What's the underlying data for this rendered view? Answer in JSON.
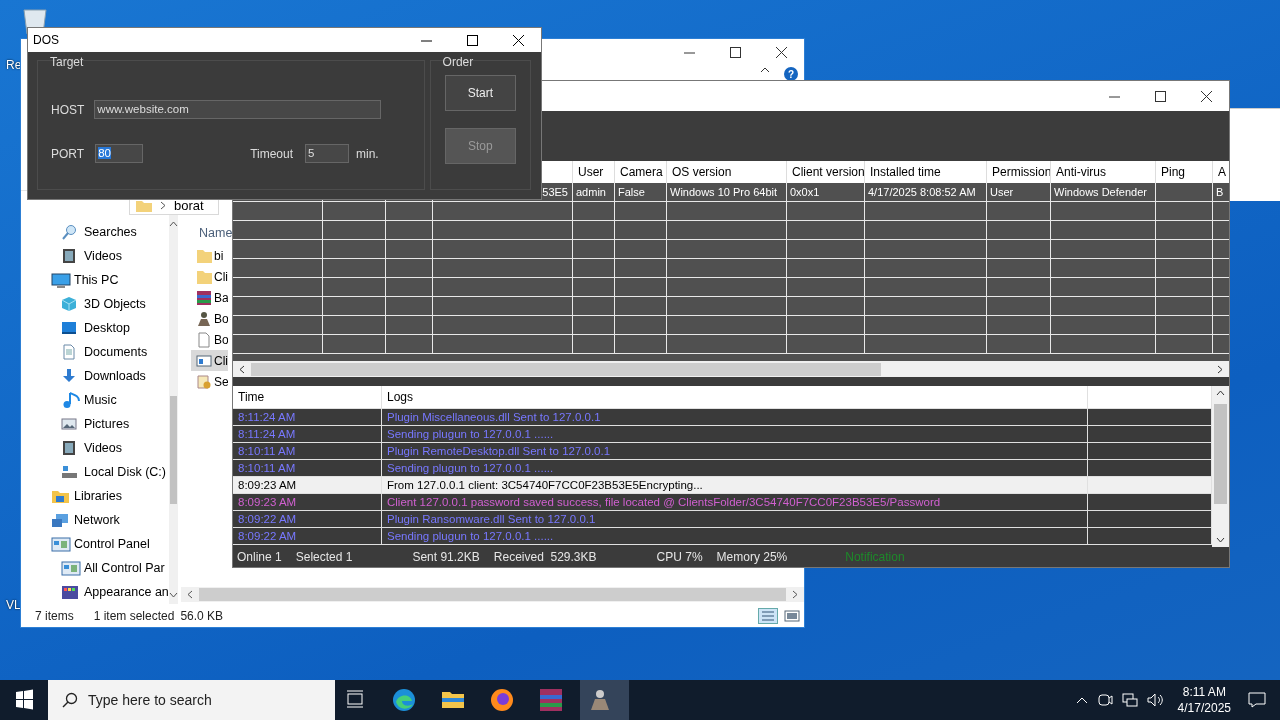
{
  "desktop": {
    "icon_labels": [
      "Re",
      "VL"
    ]
  },
  "explorer": {
    "help_glyph": "?",
    "breadcrumb": "borat",
    "column_header": "Name",
    "nav_items": [
      {
        "children": [
          {
            "label": "Searches",
            "kind": "search"
          },
          {
            "label": "Videos",
            "kind": "video"
          }
        ]
      },
      {
        "label": "This PC",
        "kind": "computer",
        "children": [
          {
            "label": "3D Objects",
            "kind": "cube"
          },
          {
            "label": "Desktop",
            "kind": "desktop"
          },
          {
            "label": "Documents",
            "kind": "document"
          },
          {
            "label": "Downloads",
            "kind": "download"
          },
          {
            "label": "Music",
            "kind": "music"
          },
          {
            "label": "Pictures",
            "kind": "picture"
          },
          {
            "label": "Videos",
            "kind": "video"
          },
          {
            "label": "Local Disk (C:)",
            "kind": "disk"
          }
        ]
      },
      {
        "label": "Libraries",
        "kind": "library"
      },
      {
        "label": "Network",
        "kind": "network"
      },
      {
        "label": "Control Panel",
        "kind": "panel",
        "children": [
          {
            "label": "All Control Par",
            "kind": "panel"
          },
          {
            "label": "Appearance an",
            "kind": "palette"
          }
        ]
      }
    ],
    "files": [
      {
        "name": "bi",
        "kind": "folder",
        "selected": false
      },
      {
        "name": "Cli",
        "kind": "folder",
        "selected": false
      },
      {
        "name": "Ba",
        "kind": "archive",
        "selected": false
      },
      {
        "name": "Bo",
        "kind": "program",
        "selected": false
      },
      {
        "name": "Bo",
        "kind": "file",
        "selected": false
      },
      {
        "name": "Cli",
        "kind": "window",
        "selected": true
      },
      {
        "name": "Se",
        "kind": "script",
        "selected": false
      }
    ],
    "status": {
      "item_count": "7 items",
      "selection": "1 item selected",
      "size": "56.0 KB"
    }
  },
  "client_manager": {
    "columns": [
      "User",
      "Camera",
      "OS version",
      "Client version",
      "Installed time",
      "Permission",
      "Anti-virus",
      "Ping",
      "A"
    ],
    "rows": [
      {
        "lead": "53E5",
        "cells": [
          "admin",
          "False",
          "Windows 10 Pro 64bit",
          "0x0x1",
          "4/17/2025 8:08:52 AM",
          "User",
          "Windows Defender",
          null,
          "B"
        ]
      }
    ],
    "log_columns": [
      "Time",
      "Logs"
    ],
    "logs": [
      {
        "time": "8:11:24 AM",
        "message": "Plugin Miscellaneous.dll Sent to 127.0.0.1",
        "color": "#7878ff",
        "selected": false
      },
      {
        "time": "8:11:24 AM",
        "message": "Sending plugun to 127.0.0.1 ......",
        "color": "#7878ff",
        "selected": false
      },
      {
        "time": "8:10:11 AM",
        "message": "Plugin RemoteDesktop.dll Sent to 127.0.0.1",
        "color": "#7878ff",
        "selected": false
      },
      {
        "time": "8:10:11 AM",
        "message": "Sending plugun to 127.0.0.1 ......",
        "color": "#7878ff",
        "selected": false
      },
      {
        "time": "8:09:23 AM",
        "message": "From 127.0.0.1 client: 3C54740F7CC0F23B53E5Encrypting...",
        "selected": true
      },
      {
        "time": "8:09:23 AM",
        "message": "Client 127.0.0.1 password saved success, file located @ ClientsFolder/3C54740F7CC0F23B53E5/Password",
        "color": "#d060d0",
        "selected": false
      },
      {
        "time": "8:09:22 AM",
        "message": "Plugin Ransomware.dll Sent to 127.0.0.1",
        "color": "#7878ff",
        "selected": false
      },
      {
        "time": "8:09:22 AM",
        "message": "Sending plugun to 127.0.0.1 ......",
        "color": "#7878ff",
        "selected": false
      }
    ],
    "status_bar": {
      "online": "Online 1",
      "selected": "Selected 1",
      "sent": "Sent 91.2KB",
      "received": "Received  529.3KB",
      "cpu": "CPU 7%",
      "memory": "Memory 25%",
      "notification": "Notification"
    }
  },
  "dos": {
    "title": "DOS",
    "target_label": "Target",
    "host_label": "HOST",
    "host_value": "www.website.com",
    "port_label": "PORT",
    "port_value": "80",
    "port_text_selected": true,
    "timeout_label": "Timeout",
    "timeout_value": "5",
    "timeout_unit": "min.",
    "order_label": "Order",
    "buttons": [
      {
        "label": "Start",
        "disabled": false
      },
      {
        "label": "Stop",
        "disabled": true
      }
    ]
  },
  "taskbar": {
    "search_placeholder": "Type here to search",
    "apps": [
      {
        "kind": "taskview",
        "active": false
      },
      {
        "kind": "edge",
        "active": false
      },
      {
        "kind": "files",
        "active": false
      },
      {
        "kind": "firefox",
        "active": false
      },
      {
        "kind": "archive",
        "active": false
      },
      {
        "kind": "app",
        "active": true
      }
    ],
    "time": "8:11 AM",
    "date": "4/17/2025"
  }
}
